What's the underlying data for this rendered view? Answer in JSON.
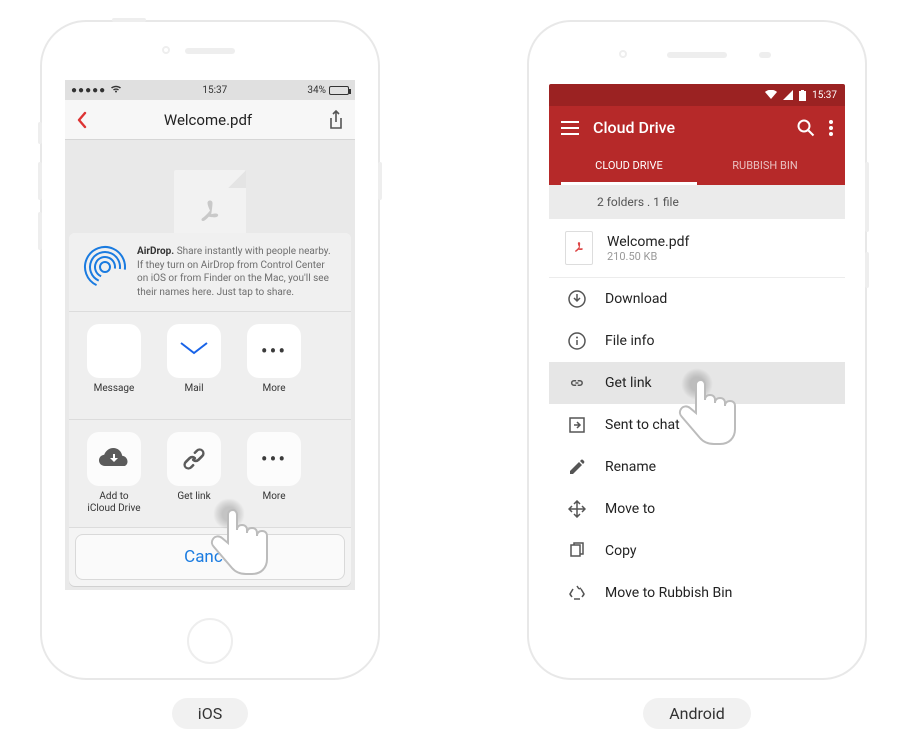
{
  "captions": {
    "ios": "iOS",
    "android": "Android"
  },
  "ios": {
    "status": {
      "time": "15:37",
      "battery_pct": "34%"
    },
    "nav": {
      "title": "Welcome.pdf"
    },
    "airdrop": {
      "bold": "AirDrop.",
      "text": "Share instantly with people nearby. If they turn on AirDrop from Control Center on iOS or from Finder on the Mac, you'll see their names here. Just tap to share."
    },
    "apps": {
      "message": "Message",
      "mail": "Mail",
      "more": "More"
    },
    "actions": {
      "icloud_line1": "Add to",
      "icloud_line2": "iCloud Drive",
      "getlink": "Get link",
      "more": "More"
    },
    "cancel": "Cancel"
  },
  "android": {
    "status": {
      "time": "15:37"
    },
    "appbar": {
      "title": "Cloud Drive"
    },
    "tabs": {
      "drive": "CLOUD DRIVE",
      "bin": "RUBBISH BIN"
    },
    "summary": "2 folders . 1 file",
    "file": {
      "name": "Welcome.pdf",
      "size": "210.50 KB"
    },
    "menu": {
      "download": "Download",
      "fileinfo": "File info",
      "getlink": "Get link",
      "sentto": "Sent to chat",
      "rename": "Rename",
      "moveto": "Move to",
      "copy": "Copy",
      "rubbish": "Move to Rubbish Bin"
    }
  }
}
